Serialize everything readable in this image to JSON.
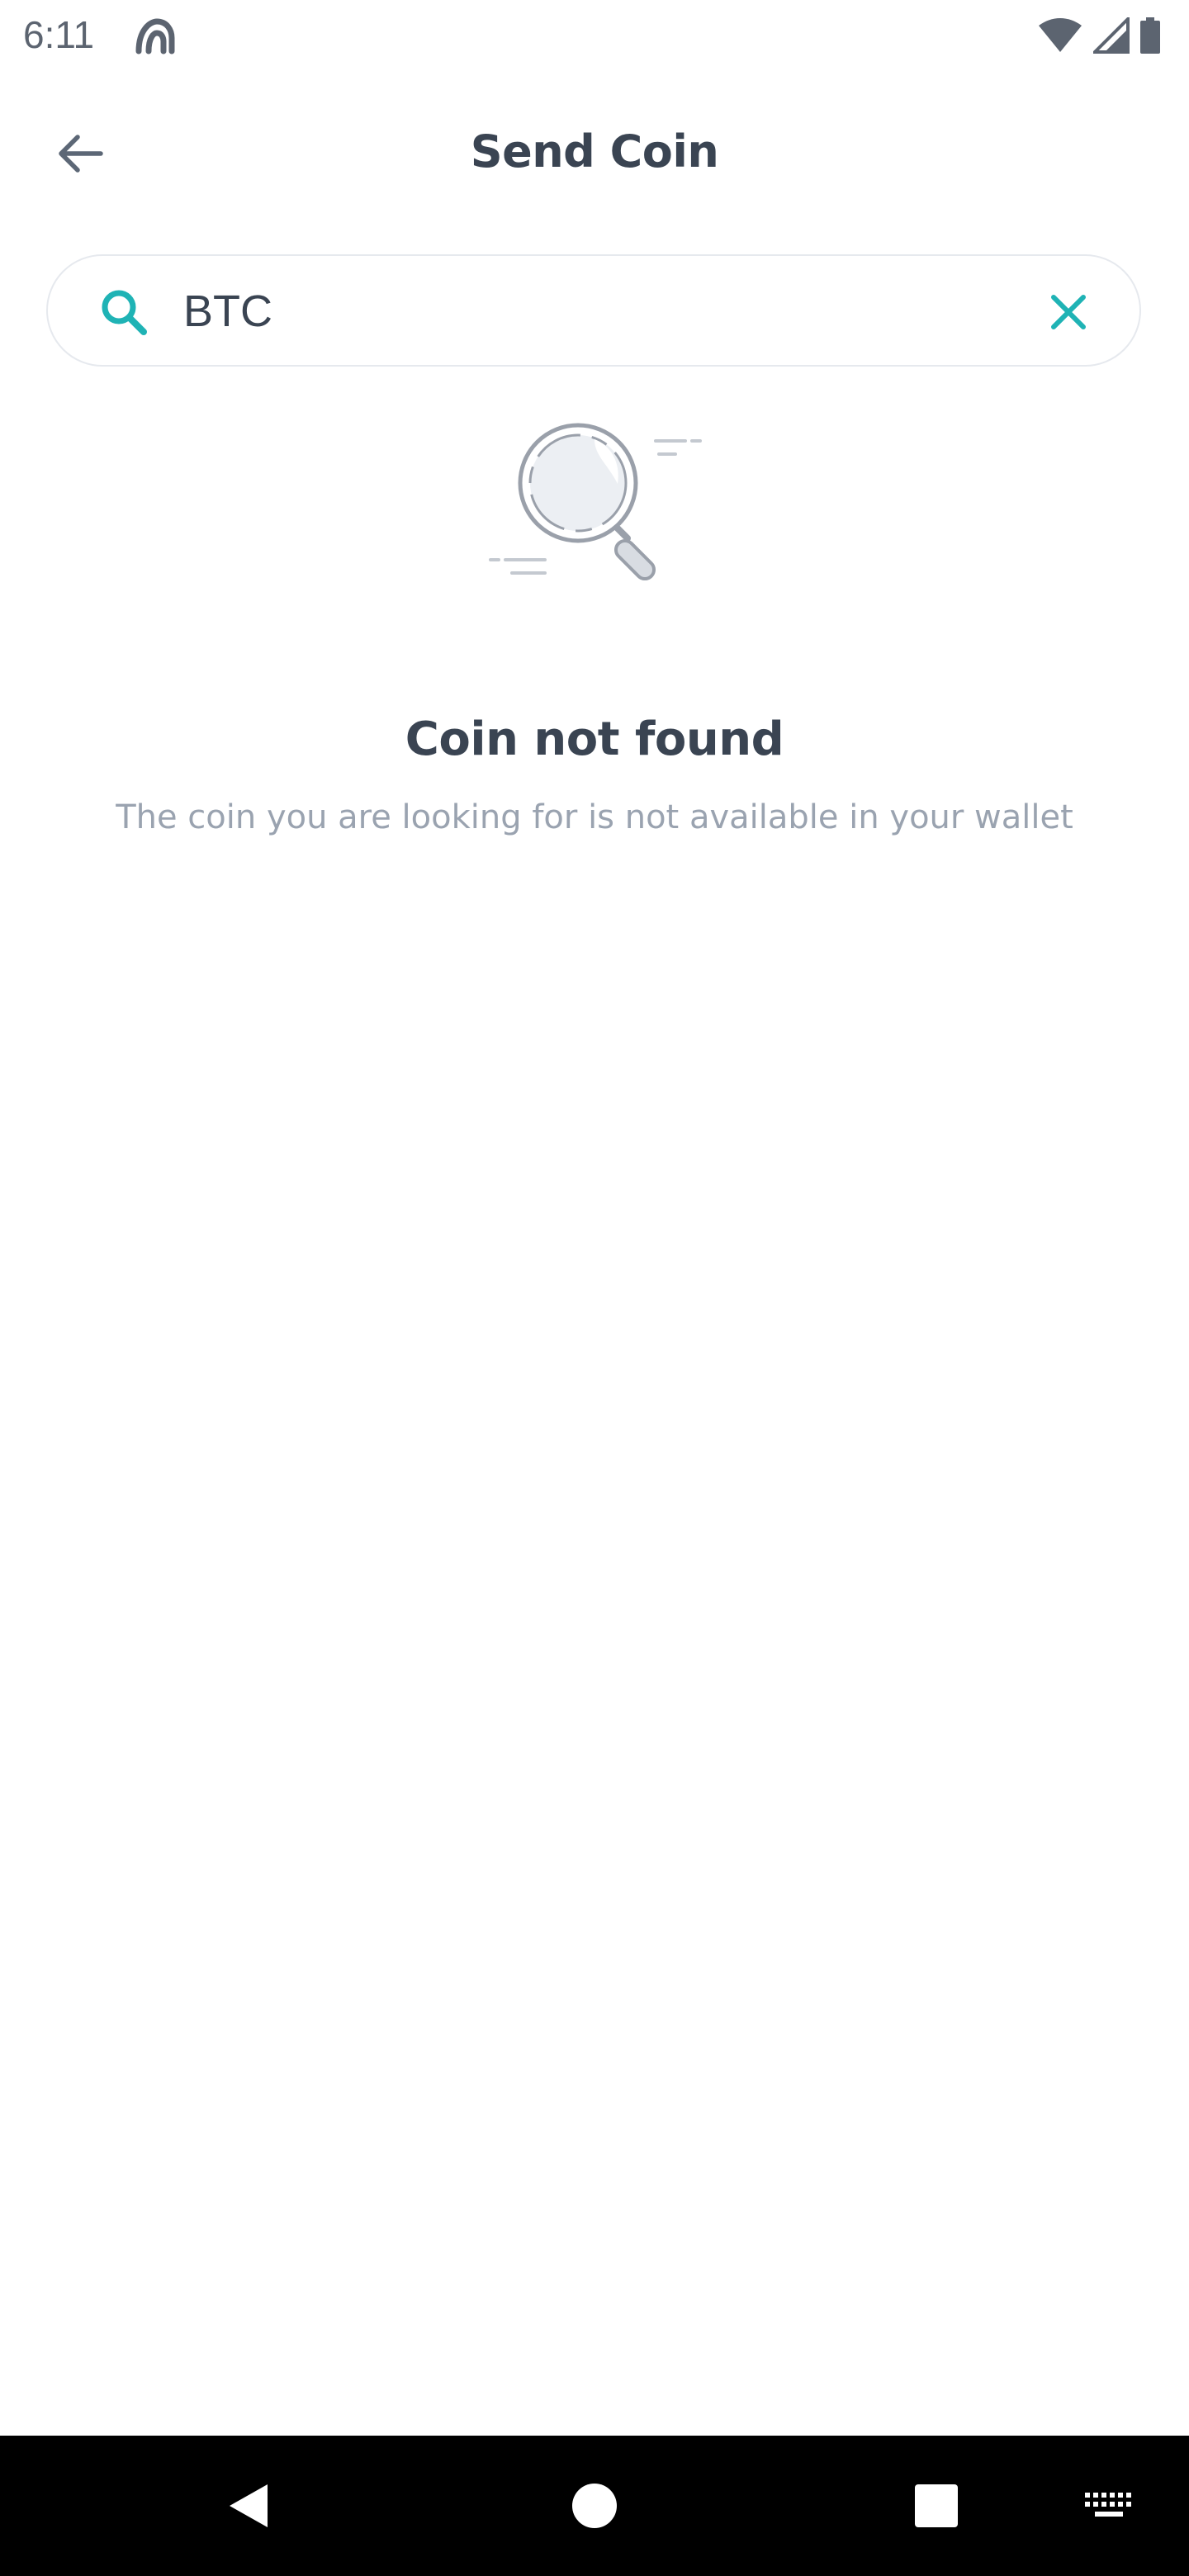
{
  "status_bar": {
    "time": "6:11",
    "app_icon": "app-notification-icon",
    "icons": [
      "wifi-icon",
      "cell-signal-icon",
      "battery-icon"
    ]
  },
  "header": {
    "title": "Send Coin",
    "back_icon": "arrow-left-icon"
  },
  "search": {
    "value": "BTC",
    "icon": "search-icon",
    "clear_icon": "close-icon"
  },
  "empty_state": {
    "illustration": "magnifier-illustration-icon",
    "title": "Coin not found",
    "message": "The coin you are looking for is not available in your wallet"
  },
  "nav_bar": {
    "buttons": [
      "back-triangle-icon",
      "home-circle-icon",
      "recents-square-icon",
      "keyboard-icon"
    ]
  },
  "colors": {
    "accent": "#1fb3b5",
    "title": "#3a4452",
    "subtitle": "#9aa3b0",
    "border": "#e6e9ee",
    "nav_bar": "#000000"
  }
}
